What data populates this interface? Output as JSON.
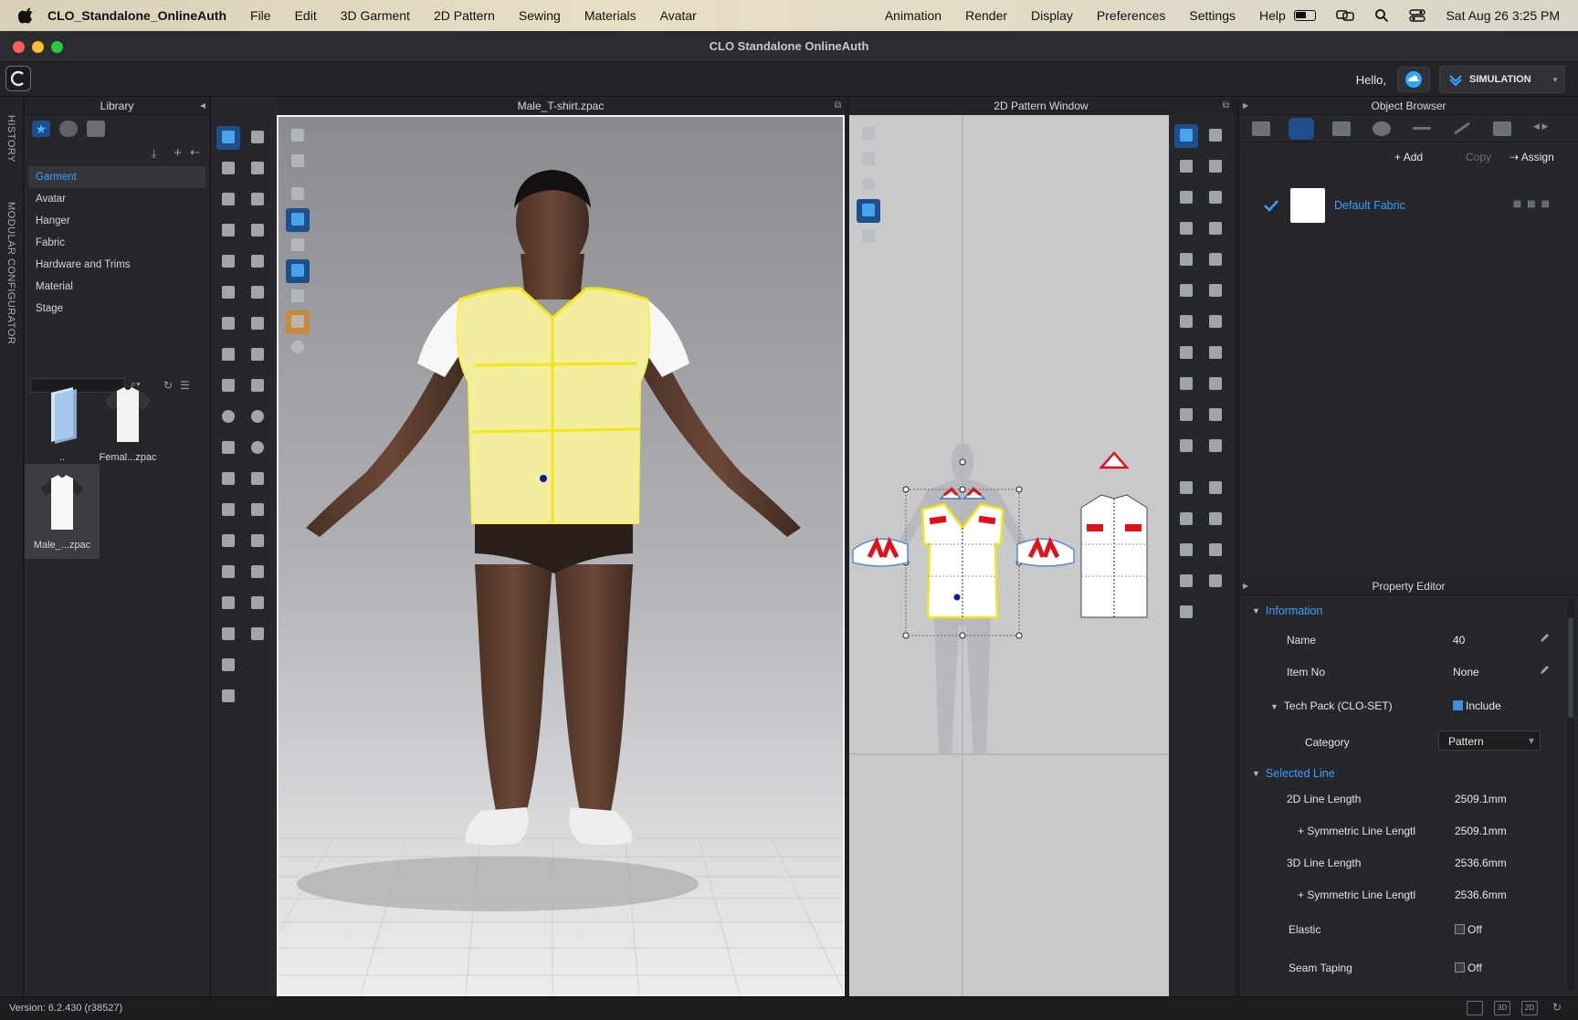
{
  "menubar": {
    "app_name": "CLO_Standalone_OnlineAuth",
    "items": [
      "File",
      "Edit",
      "3D Garment",
      "2D Pattern",
      "Sewing",
      "Materials",
      "Avatar",
      "Animation",
      "Render",
      "Display",
      "Preferences",
      "Settings",
      "Help"
    ],
    "datetime": "Sat Aug 26  3:25 PM"
  },
  "window": {
    "title": "CLO Standalone OnlineAuth"
  },
  "toolbar": {
    "hello": "Hello,",
    "simulation_label": "SIMULATION"
  },
  "rail": {
    "history": "HISTORY",
    "modular": "MODULAR CONFIGURATOR"
  },
  "library": {
    "title": "Library",
    "items": [
      "Garment",
      "Avatar",
      "Hanger",
      "Fabric",
      "Hardware and Trims",
      "Material",
      "Stage"
    ],
    "active_item": "Garment",
    "thumbs": [
      {
        "label": ".."
      },
      {
        "label": "Femal...zpac"
      },
      {
        "label": "Male_...zpac"
      }
    ]
  },
  "viewport3d": {
    "title": "Male_T-shirt.zpac"
  },
  "pattern2d": {
    "title": "2D Pattern Window"
  },
  "object_browser": {
    "title": "Object Browser",
    "add_label": "Add",
    "copy_label": "Copy",
    "assign_label": "Assign",
    "fabric_name": "Default Fabric"
  },
  "property_editor": {
    "title": "Property Editor",
    "information_label": "Information",
    "name_key": "Name",
    "name_value": "40",
    "itemno_key": "Item No",
    "itemno_value": "None",
    "techpack_key": "Tech Pack (CLO-SET)",
    "techpack_value": "Include",
    "category_key": "Category",
    "category_value": "Pattern",
    "selected_line_label": "Selected Line",
    "line2d_key": "2D Line Length",
    "line2d_value": "2509.1mm",
    "sym2d_key": "+ Symmetric Line Lengtl",
    "sym2d_value": "2509.1mm",
    "line3d_key": "3D Line Length",
    "line3d_value": "2536.6mm",
    "sym3d_key": "+ Symmetric Line Lengtl",
    "sym3d_value": "2536.6mm",
    "elastic_key": "Elastic",
    "elastic_value": "Off",
    "seam_key": "Seam Taping",
    "seam_value": "Off"
  },
  "status": {
    "version": "Version: 6.2.430 (r38527)"
  },
  "colors": {
    "accent": "#3aa0ff",
    "selected_tab": "#1f4f8a",
    "garment_yellow": "#f2ee9e",
    "pattern_red": "#e0111b"
  }
}
